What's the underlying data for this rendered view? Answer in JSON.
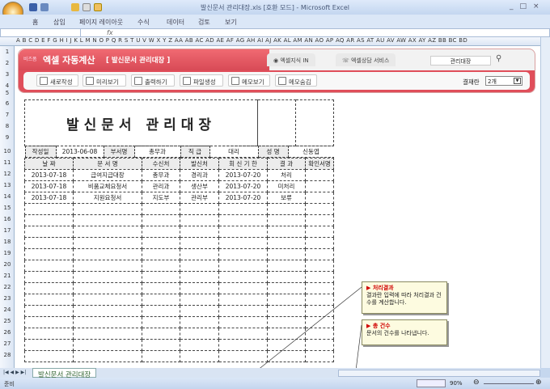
{
  "window": {
    "title": "발신문서 관리대장.xls  [호환 모드] - Microsoft Excel",
    "controls": [
      "_",
      "□",
      "×"
    ]
  },
  "ribbon_tabs": [
    "홈",
    "삽입",
    "페이지 레이아웃",
    "수식",
    "데이터",
    "검토",
    "보기"
  ],
  "formula_bar": {
    "fx": "fx",
    "value": ""
  },
  "columns": "A B C D E F G H I J K L M N O P Q R S T U V W X Y Z AA AB AC AD AE AF AG AH AI AJ AK AL AM AN AO AP AQ AR AS AT AU AV AW AX AY AZ BB BC BD",
  "banner": {
    "brand": "비즈폼",
    "app_title": "엑셀 자동계산",
    "doc_title": "[ 발신문서 관리대장 ]",
    "nav": [
      "엑셀지식 IN",
      "엑셀상담 서비스"
    ],
    "search_value": "관리대장",
    "buttons": [
      {
        "label": "새로작성",
        "icon": "refresh-icon"
      },
      {
        "label": "미리보기",
        "icon": "monitor-icon"
      },
      {
        "label": "출력하기",
        "icon": "print-icon"
      },
      {
        "label": "파일생성",
        "icon": "folder-icon"
      },
      {
        "label": "메모보기",
        "icon": "memo-icon"
      },
      {
        "label": "메모숨김",
        "icon": "memo-hide-icon"
      }
    ],
    "approval_label": "결재란",
    "approval_value": "2개"
  },
  "doc": {
    "title": "발신문서 관리대장",
    "info": [
      {
        "label": "작성일",
        "value": "2013-06-08"
      },
      {
        "label": "부서명",
        "value": "총무과"
      },
      {
        "label": "직 급",
        "value": "대리"
      },
      {
        "label": "성 명",
        "value": "신동엽"
      }
    ],
    "headers": [
      "날 짜",
      "문 서 명",
      "수신처",
      "발신처",
      "회 신 기 한",
      "결  과",
      "확인서명"
    ],
    "rows": [
      [
        "2013-07-18",
        "급여지급대장",
        "총무과",
        "경리과",
        "2013-07-20",
        "처리",
        ""
      ],
      [
        "2013-07-18",
        "비품교체요청서",
        "관리과",
        "생산부",
        "2013-07-20",
        "미처리",
        ""
      ],
      [
        "2013-07-18",
        "지원요청서",
        "지도부",
        "관리부",
        "2013-07-20",
        "보류",
        ""
      ]
    ]
  },
  "memos": [
    {
      "title": "처리결과",
      "body": "결과란 입력에 따라 처리결과 건수를 계산합니다."
    },
    {
      "title": "총 건수",
      "body": "문서의 건수를 나타냅니다."
    }
  ],
  "sheet_tab": "발신문서 관리대장",
  "status": {
    "ready": "준비",
    "zoom": "90%"
  }
}
